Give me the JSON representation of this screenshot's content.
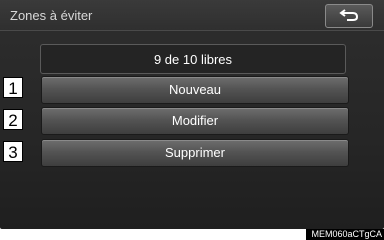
{
  "header": {
    "title": "Zones à éviter"
  },
  "status": {
    "text": "9 de 10 libres"
  },
  "buttons": [
    {
      "label": "Nouveau",
      "marker": "1"
    },
    {
      "label": "Modifier",
      "marker": "2"
    },
    {
      "label": "Supprimer",
      "marker": "3"
    }
  ],
  "footer": {
    "code": "MEM060aCTgCA"
  },
  "icons": {
    "back": "return-arrow-icon"
  }
}
